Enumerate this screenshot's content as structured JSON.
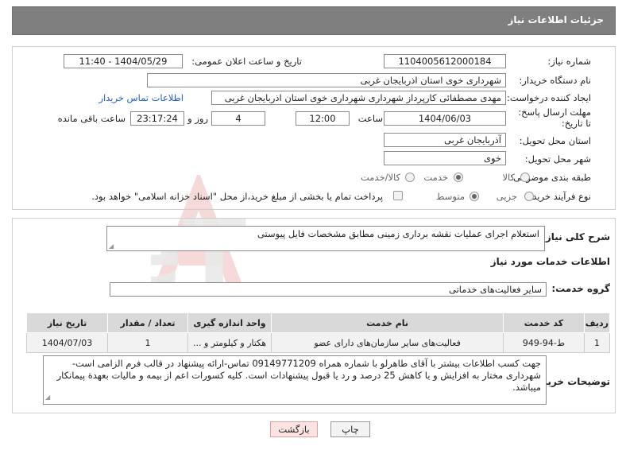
{
  "header": {
    "title": "جزئیات اطلاعات نیاز"
  },
  "form": {
    "need_number": {
      "label": "شماره نیاز:",
      "value": "1104005612000184"
    },
    "announce_datetime": {
      "label": "تاریخ و ساعت اعلان عمومی:",
      "value": "1404/05/29 - 11:40"
    },
    "buyer_org": {
      "label": "نام دستگاه خریدار:",
      "value": "شهرداری خوی استان اذربایجان غربی"
    },
    "requester": {
      "label": "ایجاد کننده درخواست:",
      "value": "مهدی مصطفائی کارپرداز شهرداری شهرداری خوی استان اذربایجان غربی",
      "contact_link": "اطلاعات تماس خریدار"
    },
    "deadline": {
      "label": "مهلت ارسال پاسخ: تا تاریخ:",
      "date": "1404/06/03",
      "time_label": "ساعت",
      "time": "12:00",
      "days": "4",
      "days_label": "روز و",
      "remaining": "23:17:24",
      "remaining_label": "ساعت باقی مانده"
    },
    "province": {
      "label": "استان محل تحویل:",
      "value": "آذربایجان غربی"
    },
    "city": {
      "label": "شهر محل تحویل:",
      "value": "خوی"
    },
    "category": {
      "label": "طبقه بندی موضوعی:",
      "options": [
        "کالا",
        "خدمت",
        "کالا/خدمت"
      ],
      "selected": "خدمت"
    },
    "process": {
      "label": "نوع فرآیند خرید :",
      "options": [
        "جزیی",
        "متوسط"
      ],
      "selected": "متوسط",
      "payment_note": "پرداخت تمام یا بخشی از مبلغ خرید،از محل \"اسناد خزانه اسلامی\" خواهد بود."
    }
  },
  "summary": {
    "label": "شرح کلی نیاز:",
    "value": "استعلام اجرای عملیات نقشه برداری زمینی مطابق مشخصات فایل پیوستی"
  },
  "services": {
    "section_title": "اطلاعات خدمات مورد نیاز",
    "group_label": "گروه خدمت:",
    "group_value": "سایر فعالیت‌های خدماتی",
    "table": {
      "headers": [
        "ردیف",
        "کد خدمت",
        "نام خدمت",
        "واحد اندازه گیری",
        "تعداد / مقدار",
        "تاریخ نیاز"
      ],
      "rows": [
        [
          "1",
          "ط-94-949",
          "فعالیت‌های سایر سازمان‌های دارای عضو",
          "هکتار و کیلومتر و ...",
          "1",
          "1404/07/03"
        ]
      ]
    }
  },
  "buyer_notes": {
    "label": "توضیحات خریدار:",
    "value": "جهت کسب اطلاعات بیشتر با آقای طاهرلو با شماره همراه 09149771209 تماس-ارائه پیشنهاد در قالب فرم الزامی است-شهرداری مختار به افزایش و یا کاهش 25 درصد و رد یا قبول پیشنهادات است. کلیه کسورات اعم از بیمه و مالیات بعهدة پیمانکار میباشد."
  },
  "buttons": {
    "print": "چاپ",
    "back": "بازگشت"
  },
  "watermark": {
    "text": "AriaTender.neT"
  },
  "colors": {
    "header_bg": "#7f7f7f",
    "link": "#2060c0",
    "back_btn_bg": "#fbe3e3"
  }
}
